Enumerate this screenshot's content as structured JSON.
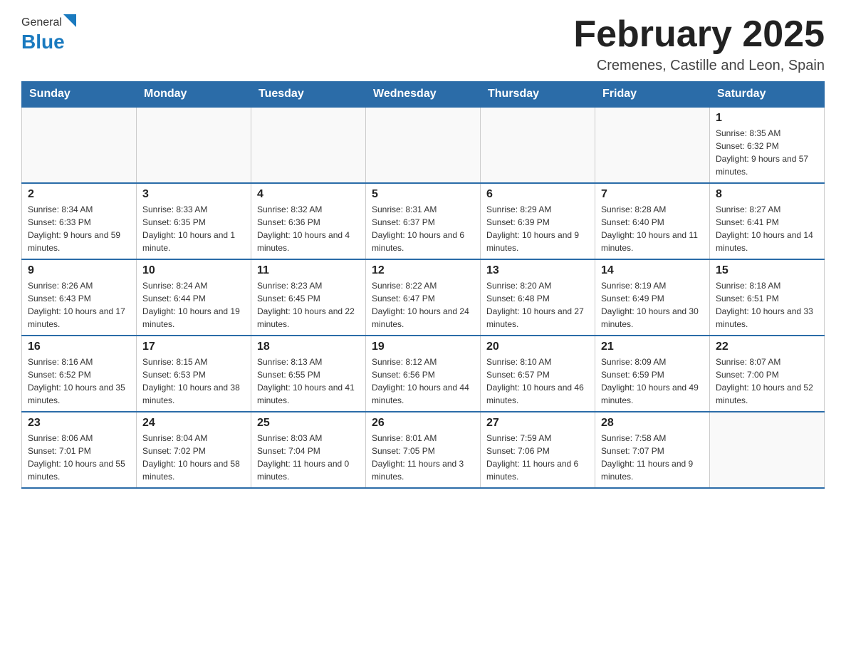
{
  "header": {
    "logo_general": "General",
    "logo_blue": "Blue",
    "title": "February 2025",
    "subtitle": "Cremenes, Castille and Leon, Spain"
  },
  "days_of_week": [
    "Sunday",
    "Monday",
    "Tuesday",
    "Wednesday",
    "Thursday",
    "Friday",
    "Saturday"
  ],
  "weeks": [
    [
      {
        "day": "",
        "info": ""
      },
      {
        "day": "",
        "info": ""
      },
      {
        "day": "",
        "info": ""
      },
      {
        "day": "",
        "info": ""
      },
      {
        "day": "",
        "info": ""
      },
      {
        "day": "",
        "info": ""
      },
      {
        "day": "1",
        "info": "Sunrise: 8:35 AM\nSunset: 6:32 PM\nDaylight: 9 hours and 57 minutes."
      }
    ],
    [
      {
        "day": "2",
        "info": "Sunrise: 8:34 AM\nSunset: 6:33 PM\nDaylight: 9 hours and 59 minutes."
      },
      {
        "day": "3",
        "info": "Sunrise: 8:33 AM\nSunset: 6:35 PM\nDaylight: 10 hours and 1 minute."
      },
      {
        "day": "4",
        "info": "Sunrise: 8:32 AM\nSunset: 6:36 PM\nDaylight: 10 hours and 4 minutes."
      },
      {
        "day": "5",
        "info": "Sunrise: 8:31 AM\nSunset: 6:37 PM\nDaylight: 10 hours and 6 minutes."
      },
      {
        "day": "6",
        "info": "Sunrise: 8:29 AM\nSunset: 6:39 PM\nDaylight: 10 hours and 9 minutes."
      },
      {
        "day": "7",
        "info": "Sunrise: 8:28 AM\nSunset: 6:40 PM\nDaylight: 10 hours and 11 minutes."
      },
      {
        "day": "8",
        "info": "Sunrise: 8:27 AM\nSunset: 6:41 PM\nDaylight: 10 hours and 14 minutes."
      }
    ],
    [
      {
        "day": "9",
        "info": "Sunrise: 8:26 AM\nSunset: 6:43 PM\nDaylight: 10 hours and 17 minutes."
      },
      {
        "day": "10",
        "info": "Sunrise: 8:24 AM\nSunset: 6:44 PM\nDaylight: 10 hours and 19 minutes."
      },
      {
        "day": "11",
        "info": "Sunrise: 8:23 AM\nSunset: 6:45 PM\nDaylight: 10 hours and 22 minutes."
      },
      {
        "day": "12",
        "info": "Sunrise: 8:22 AM\nSunset: 6:47 PM\nDaylight: 10 hours and 24 minutes."
      },
      {
        "day": "13",
        "info": "Sunrise: 8:20 AM\nSunset: 6:48 PM\nDaylight: 10 hours and 27 minutes."
      },
      {
        "day": "14",
        "info": "Sunrise: 8:19 AM\nSunset: 6:49 PM\nDaylight: 10 hours and 30 minutes."
      },
      {
        "day": "15",
        "info": "Sunrise: 8:18 AM\nSunset: 6:51 PM\nDaylight: 10 hours and 33 minutes."
      }
    ],
    [
      {
        "day": "16",
        "info": "Sunrise: 8:16 AM\nSunset: 6:52 PM\nDaylight: 10 hours and 35 minutes."
      },
      {
        "day": "17",
        "info": "Sunrise: 8:15 AM\nSunset: 6:53 PM\nDaylight: 10 hours and 38 minutes."
      },
      {
        "day": "18",
        "info": "Sunrise: 8:13 AM\nSunset: 6:55 PM\nDaylight: 10 hours and 41 minutes."
      },
      {
        "day": "19",
        "info": "Sunrise: 8:12 AM\nSunset: 6:56 PM\nDaylight: 10 hours and 44 minutes."
      },
      {
        "day": "20",
        "info": "Sunrise: 8:10 AM\nSunset: 6:57 PM\nDaylight: 10 hours and 46 minutes."
      },
      {
        "day": "21",
        "info": "Sunrise: 8:09 AM\nSunset: 6:59 PM\nDaylight: 10 hours and 49 minutes."
      },
      {
        "day": "22",
        "info": "Sunrise: 8:07 AM\nSunset: 7:00 PM\nDaylight: 10 hours and 52 minutes."
      }
    ],
    [
      {
        "day": "23",
        "info": "Sunrise: 8:06 AM\nSunset: 7:01 PM\nDaylight: 10 hours and 55 minutes."
      },
      {
        "day": "24",
        "info": "Sunrise: 8:04 AM\nSunset: 7:02 PM\nDaylight: 10 hours and 58 minutes."
      },
      {
        "day": "25",
        "info": "Sunrise: 8:03 AM\nSunset: 7:04 PM\nDaylight: 11 hours and 0 minutes."
      },
      {
        "day": "26",
        "info": "Sunrise: 8:01 AM\nSunset: 7:05 PM\nDaylight: 11 hours and 3 minutes."
      },
      {
        "day": "27",
        "info": "Sunrise: 7:59 AM\nSunset: 7:06 PM\nDaylight: 11 hours and 6 minutes."
      },
      {
        "day": "28",
        "info": "Sunrise: 7:58 AM\nSunset: 7:07 PM\nDaylight: 11 hours and 9 minutes."
      },
      {
        "day": "",
        "info": ""
      }
    ]
  ]
}
